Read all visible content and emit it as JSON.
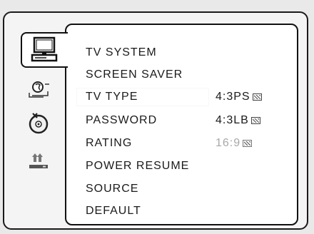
{
  "sidebar": {
    "icons": [
      {
        "name": "monitor-icon",
        "selected": true
      },
      {
        "name": "audio-icon",
        "selected": false
      },
      {
        "name": "disc-icon",
        "selected": false
      },
      {
        "name": "speaker-setup-icon",
        "selected": false
      }
    ]
  },
  "menu": {
    "items": [
      "TV  SYSTEM",
      "SCREEN SAVER",
      "TV TYPE",
      "PASSWORD",
      "RATING",
      "POWER RESUME",
      "SOURCE",
      "DEFAULT"
    ],
    "highlighted_index": 2
  },
  "submenu": {
    "options": [
      {
        "label": "4:3PS",
        "state": "enabled"
      },
      {
        "label": "4:3LB",
        "state": "enabled"
      },
      {
        "label": "16:9",
        "state": "disabled"
      }
    ]
  }
}
